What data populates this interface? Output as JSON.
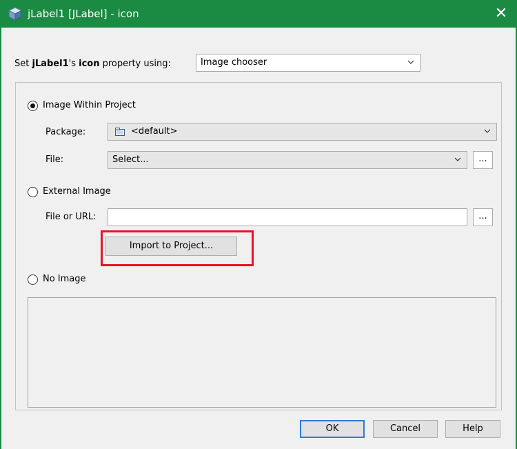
{
  "window": {
    "title": "jLabel1 [JLabel] - icon",
    "close_symbol": "✕",
    "accent": "#1b8a43"
  },
  "property": {
    "prefix": "Set ",
    "component": "jLabel1",
    "possessive": "'s ",
    "property_name": "icon",
    "suffix": " property using:",
    "mode_selected": "Image chooser"
  },
  "sources": {
    "within_project": {
      "label": "Image Within Project",
      "selected": true,
      "package_label": "Package:",
      "package_value": "<default>",
      "file_label": "File:",
      "file_value": "Select...",
      "browse_label": "..."
    },
    "external": {
      "label": "External Image",
      "selected": false,
      "file_label": "File or URL:",
      "file_value": "",
      "browse_label": "...",
      "import_label": "Import to Project..."
    },
    "none": {
      "label": "No Image",
      "selected": false
    }
  },
  "buttons": {
    "ok": "OK",
    "cancel": "Cancel",
    "help": "Help"
  },
  "icons": {
    "title": "cube-icon",
    "package": "package-icon",
    "chevron": "chevron-down-icon"
  }
}
